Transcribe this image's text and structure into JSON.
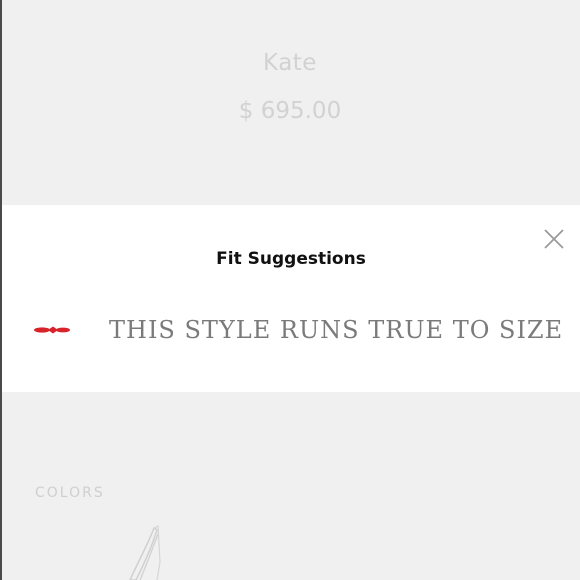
{
  "product": {
    "name": "Kate",
    "price": "$ 695.00",
    "colors_label": "COLORS"
  },
  "modal": {
    "title": "Fit Suggestions",
    "fit_text": "THIS STYLE RUNS TRUE TO SIZE",
    "close_icon": "close-icon",
    "brand_icon": "red-sole-icon"
  },
  "colors": {
    "background": "#f0f0f0",
    "modal_background": "#ffffff",
    "accent_red": "#d8232a",
    "fit_text": "#7a7a7a"
  }
}
